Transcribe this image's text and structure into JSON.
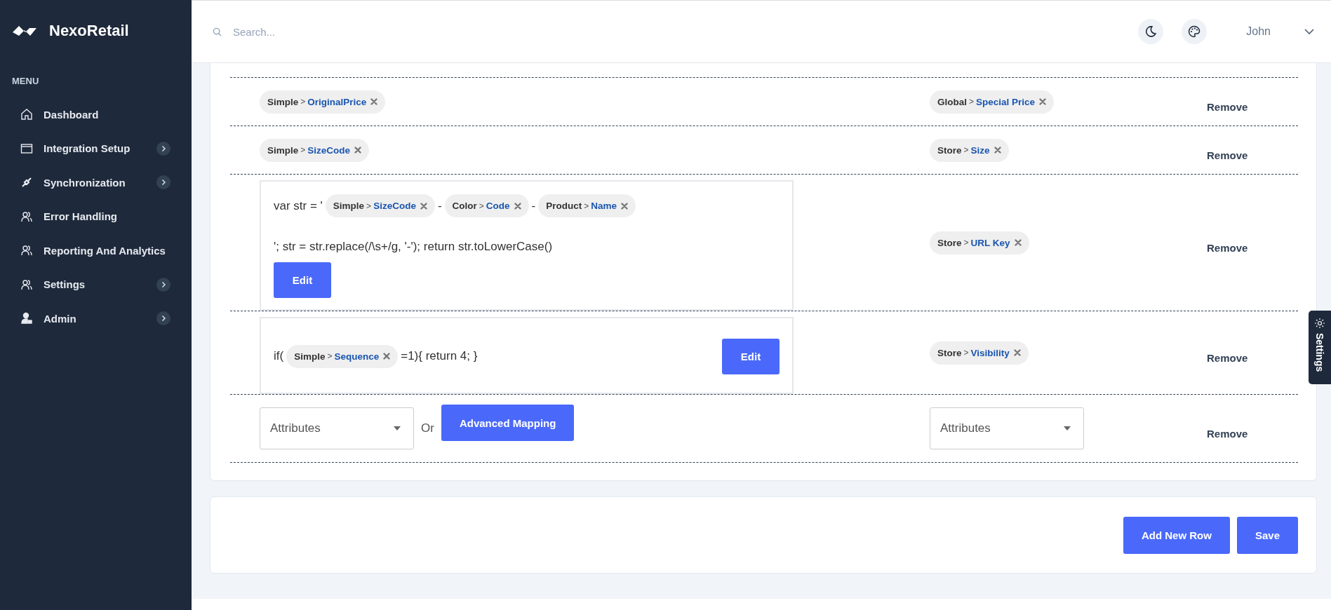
{
  "sidebar": {
    "brand": "NexoRetail",
    "menu_label": "MENU",
    "items": [
      {
        "label": "Dashboard",
        "has_submenu": false
      },
      {
        "label": "Integration Setup",
        "has_submenu": true
      },
      {
        "label": "Synchronization",
        "has_submenu": true
      },
      {
        "label": "Error Handling",
        "has_submenu": false
      },
      {
        "label": "Reporting And Analytics",
        "has_submenu": false
      },
      {
        "label": "Settings",
        "has_submenu": true
      },
      {
        "label": "Admin",
        "has_submenu": true
      }
    ]
  },
  "header": {
    "search": {
      "placeholder": "Search..."
    },
    "user": "John"
  },
  "mapping_rows": [
    {
      "source": {
        "kind": "tag",
        "tag": {
          "scope": "Simple",
          "separator": ">",
          "attribute": "OriginalPrice"
        }
      },
      "target": {
        "kind": "tag",
        "tag": {
          "scope": "Global",
          "separator": ">",
          "attribute": "Special Price"
        }
      },
      "remove": "Remove"
    },
    {
      "source": {
        "kind": "tag",
        "tag": {
          "scope": "Simple",
          "separator": ">",
          "attribute": "SizeCode"
        }
      },
      "target": {
        "kind": "tag",
        "tag": {
          "scope": "Store",
          "separator": ">",
          "attribute": "Size"
        }
      },
      "remove": "Remove"
    },
    {
      "source": {
        "kind": "script",
        "edit_inline": false,
        "edit": "Edit",
        "segments": [
          {
            "kind": "text",
            "text": "var str = '"
          },
          {
            "kind": "tag",
            "tag": {
              "scope": "Simple",
              "separator": ">",
              "attribute": "SizeCode"
            }
          },
          {
            "kind": "text",
            "text": "-"
          },
          {
            "kind": "tag",
            "tag": {
              "scope": "Color",
              "separator": ">",
              "attribute": "Code"
            }
          },
          {
            "kind": "text",
            "text": "-"
          },
          {
            "kind": "tag",
            "tag": {
              "scope": "Product",
              "separator": ">",
              "attribute": "Name"
            }
          },
          {
            "kind": "break"
          },
          {
            "kind": "text",
            "text": "'; str = str.replace(/\\s+/g, '-'); return str.toLowerCase()"
          }
        ]
      },
      "target": {
        "kind": "tag",
        "tag": {
          "scope": "Store",
          "separator": ">",
          "attribute": "URL Key"
        }
      },
      "remove": "Remove"
    },
    {
      "source": {
        "kind": "script",
        "edit_inline": true,
        "edit": "Edit",
        "segments": [
          {
            "kind": "text",
            "text": "if("
          },
          {
            "kind": "tag",
            "tag": {
              "scope": "Simple",
              "separator": ">",
              "attribute": "Sequence"
            }
          },
          {
            "kind": "text",
            "text": "=1){ return 4; }"
          }
        ]
      },
      "target": {
        "kind": "tag",
        "tag": {
          "scope": "Store",
          "separator": ">",
          "attribute": "Visibility"
        }
      },
      "remove": "Remove"
    },
    {
      "source": {
        "kind": "select",
        "placeholder": "Attributes",
        "or": "Or",
        "advanced": "Advanced Mapping"
      },
      "target": {
        "kind": "select",
        "placeholder": "Attributes"
      },
      "remove": "Remove"
    }
  ],
  "actions": [
    "Add New Row",
    "Save"
  ],
  "settings_tab": "Settings"
}
